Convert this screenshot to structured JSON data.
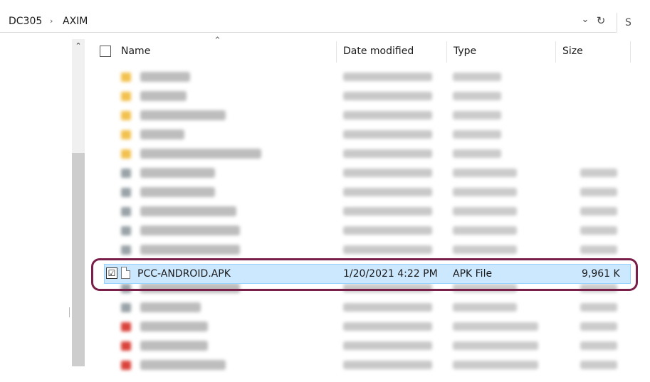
{
  "address_bar": {
    "breadcrumbs": [
      "DC305",
      "AXIM"
    ],
    "separator": "›",
    "dropdown_icon": "chevron-down-icon",
    "refresh_icon": "refresh-icon",
    "search_stub": "S"
  },
  "columns": {
    "name": "Name",
    "date_modified": "Date modified",
    "type": "Type",
    "size": "Size"
  },
  "selected_row": {
    "checked": "☑",
    "name": "PCC-ANDROID.APK",
    "date_modified": "1/20/2021 4:22 PM",
    "type": "APK File",
    "size": "9,961 K"
  },
  "blurred_rows_note": "",
  "blurred_rows": [
    {
      "icon": "folder-icon",
      "color": "#f2c14e"
    },
    {
      "icon": "folder-icon",
      "color": "#f2c14e"
    },
    {
      "icon": "folder-icon",
      "color": "#f2c14e"
    },
    {
      "icon": "folder-icon",
      "color": "#f2c14e"
    },
    {
      "icon": "folder-icon",
      "color": "#f2c14e"
    },
    {
      "icon": "cab-file-icon",
      "color": "#9aa3a8"
    },
    {
      "icon": "cab-file-icon",
      "color": "#9aa3a8"
    },
    {
      "icon": "cab-file-icon",
      "color": "#9aa3a8"
    },
    {
      "icon": "cab-file-icon",
      "color": "#9aa3a8"
    },
    {
      "icon": "cab-file-icon",
      "color": "#9aa3a8"
    },
    {
      "icon": "cab-file-icon",
      "color": "#9aa3a8"
    },
    {
      "icon": "cab-file-icon",
      "color": "#9aa3a8"
    },
    {
      "icon": "chrome-html-icon",
      "color": "#d9433b"
    },
    {
      "icon": "chrome-html-icon",
      "color": "#d9433b"
    },
    {
      "icon": "chrome-html-icon",
      "color": "#d9433b"
    }
  ],
  "colors": {
    "selection_fill": "#cce8ff",
    "selection_border": "#99d1ff",
    "highlight_ring": "#7a1f4a"
  }
}
